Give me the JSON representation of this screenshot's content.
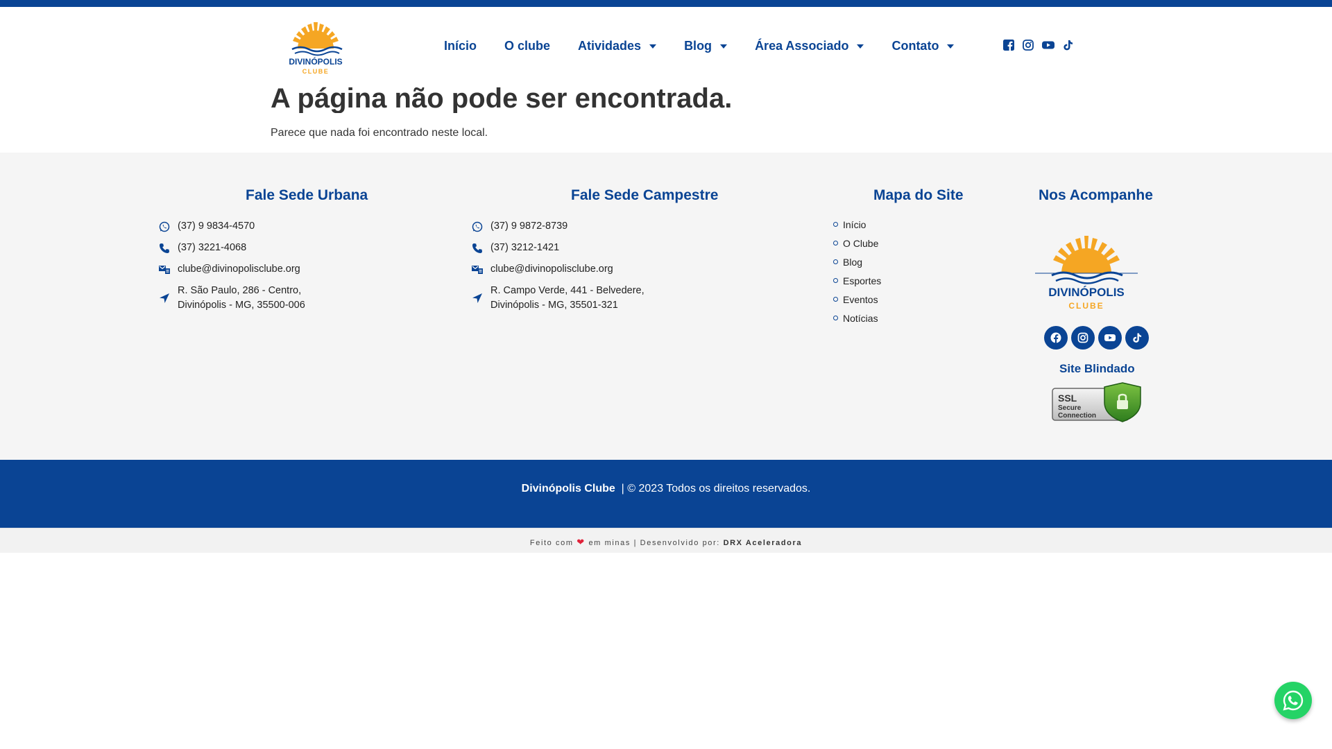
{
  "header": {
    "logo_title": "DIVINÓPOLIS",
    "logo_subtitle": "CLUBE",
    "nav": [
      {
        "label": "Início",
        "dropdown": false
      },
      {
        "label": "O clube",
        "dropdown": false
      },
      {
        "label": "Atividades",
        "dropdown": true
      },
      {
        "label": "Blog",
        "dropdown": true
      },
      {
        "label": "Área Associado",
        "dropdown": true
      },
      {
        "label": "Contato",
        "dropdown": true
      }
    ],
    "social_icons": [
      "facebook-icon",
      "instagram-icon",
      "youtube-icon",
      "tiktok-icon"
    ]
  },
  "error": {
    "title": "A página não pode ser encontrada.",
    "message": "Parece que nada foi encontrado neste local."
  },
  "footer": {
    "urbana": {
      "title": "Fale Sede Urbana",
      "whatsapp": "(37) 9 9834-4570",
      "phone": "(37) 3221-4068",
      "email": "clube@divinopolisclube.org",
      "address_line1": "R. São Paulo, 286 - Centro,",
      "address_line2": "Divinópolis - MG, 35500-006"
    },
    "campestre": {
      "title": "Fale Sede Campestre",
      "whatsapp": "(37) 9 9872-8739",
      "phone": "(37) 3212-1421",
      "email": "clube@divinopolisclube.org",
      "address_line1": "R. Campo Verde, 441 - Belvedere,",
      "address_line2": "Divinópolis - MG, 35501-321"
    },
    "sitemap": {
      "title": "Mapa do Site",
      "items": [
        "Início",
        "O Clube",
        "Blog",
        "Esportes",
        "Eventos",
        "Notícias"
      ]
    },
    "follow": {
      "title": "Nos Acompanhe",
      "logo_title": "DIVINÓPOLIS",
      "logo_subtitle": "CLUBE",
      "blind_title": "Site Blindado",
      "ssl_line1": "SSL",
      "ssl_line2": "Secure",
      "ssl_line3": "Connection"
    }
  },
  "copyright": {
    "brand": "Divinópolis Clube",
    "text": "| © 2023  Todos os direitos reservados."
  },
  "credit": {
    "before": "Feito com",
    "after": "em minas | Desenvolvido por:",
    "company": "DRX Aceleradora"
  },
  "colors": {
    "primary": "#0a4494",
    "accent": "#f5a623",
    "whatsapp": "#25d366"
  }
}
